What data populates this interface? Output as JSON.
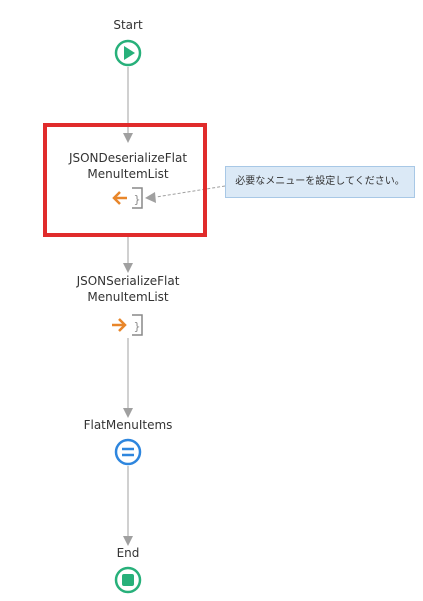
{
  "flow": {
    "nodes": {
      "start": {
        "label": "Start",
        "icon": "play-icon",
        "color": "#27b07a"
      },
      "deserialize": {
        "line1": "JSONDeserializeFlat",
        "line2": "MenuItemList",
        "icon": "json-deserialize-icon",
        "color": "#e8862a"
      },
      "serialize": {
        "line1": "JSONSerializeFlat",
        "line2": "MenuItemList",
        "icon": "json-serialize-icon",
        "color": "#e8862a"
      },
      "assign": {
        "label": "FlatMenuItems",
        "icon": "assign-icon",
        "color": "#2e86de"
      },
      "end": {
        "label": "End",
        "icon": "stop-icon",
        "color": "#27b07a"
      }
    },
    "comment": {
      "text": "必要なメニューを設定してください。"
    },
    "colors": {
      "connector": "#a0a0a0",
      "selection": "#e02b2b",
      "comment_bg": "#dbe9f6"
    }
  }
}
